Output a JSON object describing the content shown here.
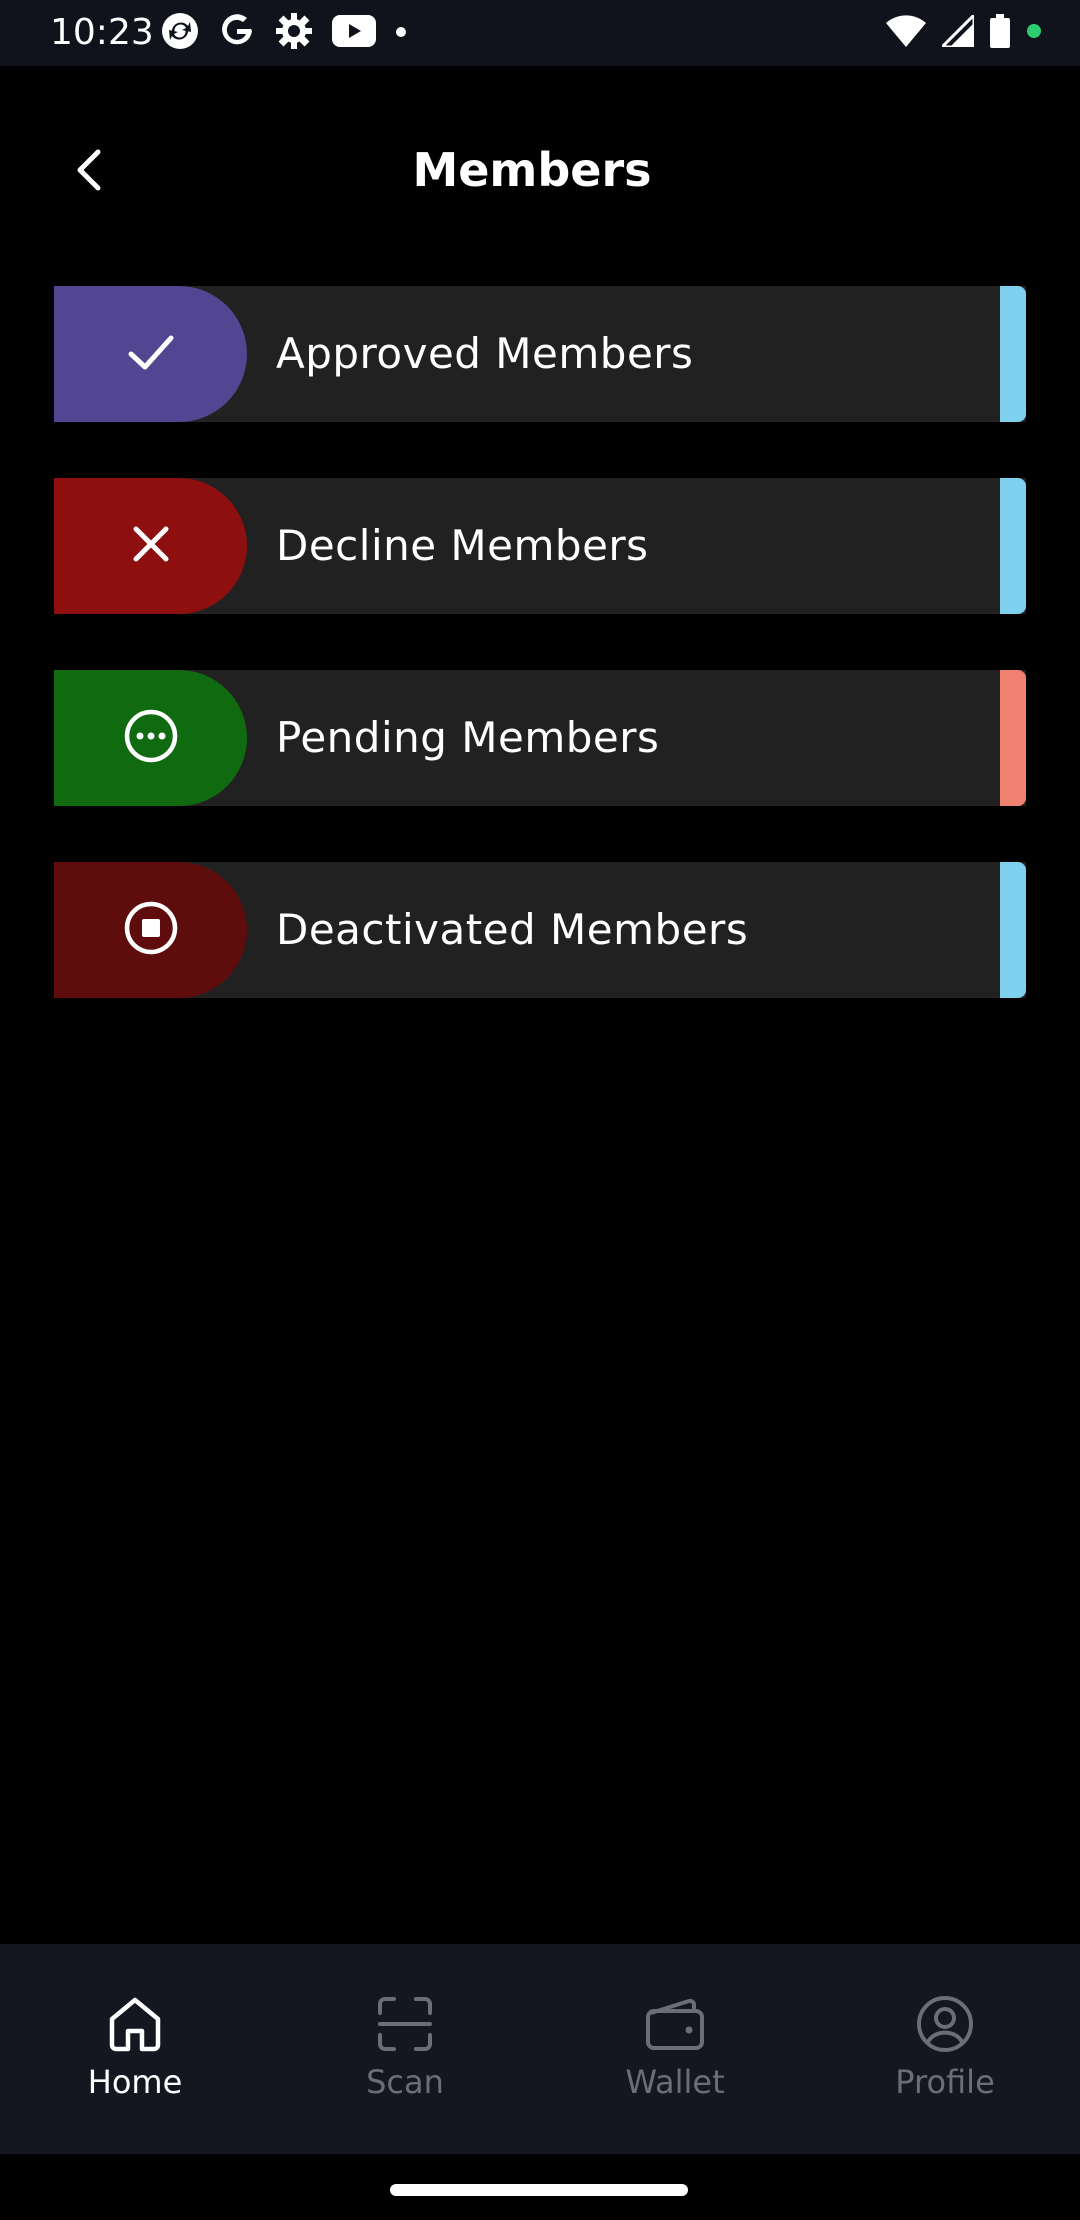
{
  "status_bar": {
    "time": "10:23",
    "left_icons": [
      "sync-icon",
      "google-icon",
      "settings-icon",
      "youtube-icon",
      "dot-icon"
    ],
    "right_icons": [
      "wifi-icon",
      "signal-icon",
      "battery-icon",
      "green-dot-icon"
    ]
  },
  "header": {
    "title": "Members",
    "back_icon": "chevron-left-icon"
  },
  "members": {
    "items": [
      {
        "label": "Approved Members",
        "icon": "check-icon",
        "pill_color": "#524591",
        "edge_color": "#7fd0ee"
      },
      {
        "label": "Decline Members",
        "icon": "close-icon",
        "pill_color": "#8e0f0f",
        "edge_color": "#7fd0ee"
      },
      {
        "label": "Pending Members",
        "icon": "more-circle-icon",
        "pill_color": "#0f6a10",
        "edge_color": "#f08070"
      },
      {
        "label": "Deactivated Members",
        "icon": "stop-circle-icon",
        "pill_color": "#5e0c0c",
        "edge_color": "#7fd0ee"
      }
    ]
  },
  "bottom_nav": {
    "items": [
      {
        "label": "Home",
        "icon": "home-icon",
        "active": true
      },
      {
        "label": "Scan",
        "icon": "scan-icon",
        "active": false
      },
      {
        "label": "Wallet",
        "icon": "wallet-icon",
        "active": false
      },
      {
        "label": "Profile",
        "icon": "profile-icon",
        "active": false
      }
    ],
    "active_color": "#ffffff",
    "inactive_color": "#6b6e76"
  }
}
